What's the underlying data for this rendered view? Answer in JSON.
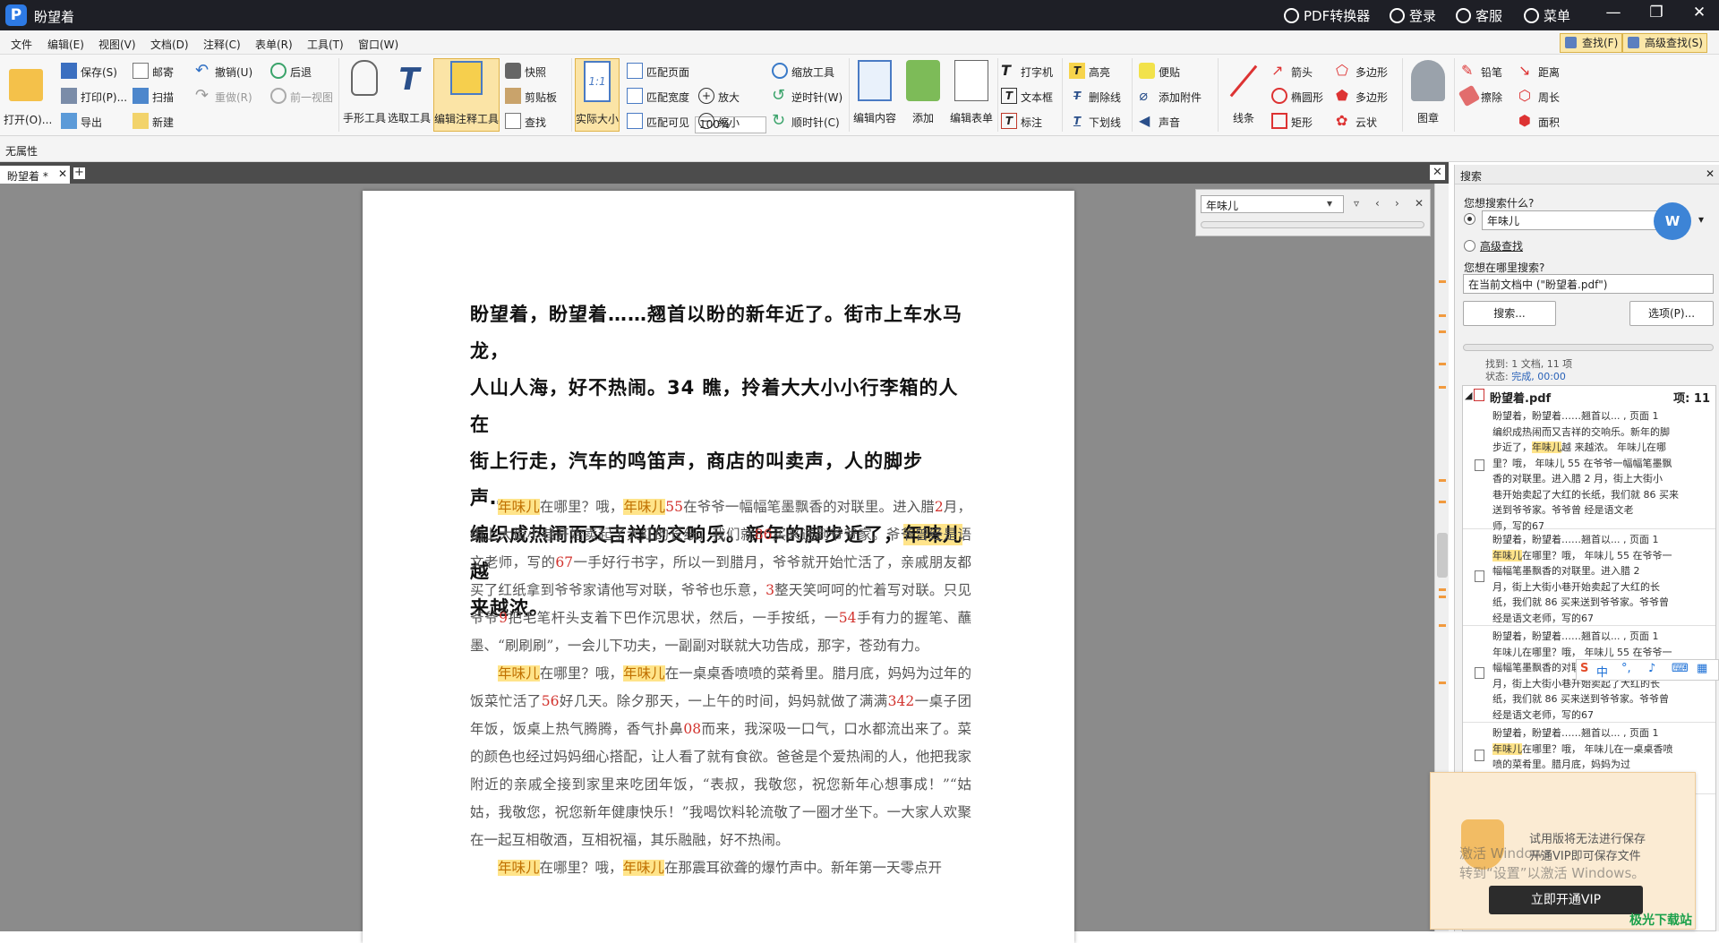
{
  "titlebar": {
    "app_title": "盼望着",
    "pdf_converter": "PDF转换器",
    "login": "登录",
    "service": "客服",
    "menu": "菜单"
  },
  "menubar": {
    "items": [
      "文件",
      "编辑(E)",
      "视图(V)",
      "文档(D)",
      "注释(C)",
      "表单(R)",
      "工具(T)",
      "窗口(W)"
    ],
    "find_btn": "查找(F)",
    "adv_find_btn": "高级查找(S)"
  },
  "ribbon": {
    "open": "打开(O)...",
    "save": "保存(S)",
    "print": "打印(P)...",
    "export": "导出",
    "email": "邮寄",
    "scan": "扫描",
    "new": "新建",
    "undo": "撤销(U)",
    "redo": "重做(R)",
    "back": "后退",
    "forward": "前一视图",
    "hand": "手形工具",
    "select": "选取工具",
    "edit_annot": "编辑注释工具",
    "snapshot": "快照",
    "clipboard": "剪贴板",
    "find": "查找",
    "actual_size": "实际大小",
    "fit_page": "匹配页面",
    "fit_width": "匹配宽度",
    "fit_visible": "匹配可见",
    "zoom_value": "100%",
    "zoom_in": "放大",
    "zoom_out": "缩小",
    "zoom_tool": "缩放工具",
    "ccw": "逆时针(W)",
    "cw": "顺时针(C)",
    "edit_content": "编辑内容",
    "add": "添加",
    "edit_form": "编辑表单",
    "typewriter": "打字机",
    "textbox": "文本框",
    "callout": "标注",
    "highlight": "高亮",
    "strikeout": "删除线",
    "underline": "下划线",
    "note": "便贴",
    "attach": "添加附件",
    "sound": "声音",
    "line": "线条",
    "arrow": "箭头",
    "ellipse": "椭圆形",
    "rect": "矩形",
    "polygon": "多边形",
    "polyline": "多边形",
    "cloud": "云状",
    "stamp": "图章",
    "pencil": "铅笔",
    "eraser": "擦除",
    "distance": "距离",
    "perimeter": "周长",
    "area": "面积"
  },
  "props": {
    "label": "无属性"
  },
  "tab": {
    "name": "盼望着 *"
  },
  "doc": {
    "heading": [
      "盼望着，盼望着……翘首以盼的新年近了。街市上车水马龙，",
      "人山人海，好不热闹。34 瞧，拎着大大小小行李箱的人在",
      "街上行走，汽车的鸣笛声，商店的叫卖声，人的脚步声……",
      "编织成热闹而又吉祥的交响乐。新年的脚步近了，",
      "年味儿",
      "越",
      "来越浓。"
    ],
    "p1": [
      "年味儿",
      "在哪里？哦，",
      "年味儿",
      "55",
      "在爷爷一幅幅笔墨飘香的对联里。进入腊",
      "2",
      "月，街上大街小巷开始卖起了大红的长纸，我们就",
      "86",
      "买来送到爷爷家。爷爷曾经是语文老师，写的",
      "67",
      "一手好行书字，所以一到腊月，爷爷就开始忙活了，亲戚朋友都买了红纸拿到爷爷家请他写对联，爷爷也乐意，",
      "3",
      "整天笑呵呵的忙着写对联。只见爷爷",
      "9",
      "把毛笔杆头支着下巴作沉思状，然后，一手按纸，一",
      "54",
      "手有力的握笔、蘸墨、“刷刷刷”，一会儿下功夫，一副副对联就大功告成，那字，苍劲有力。"
    ],
    "p2": [
      "年味儿",
      "在哪里？哦，",
      "年味儿",
      "在一桌桌香喷喷的菜肴里。腊月底，妈妈为过年的饭菜忙活了",
      "56",
      "好几天。除夕那天，一上午的时间，妈妈就做了满满",
      "342",
      "一桌子团年饭，饭桌上热气腾腾，香气扑鼻",
      "08",
      "而来，我深吸一口气，口水都流出来了。菜的颜色也经过妈妈细心搭配，让人看了就有食欲。爸爸是个爱热闹的人，他把我家附近的亲戚全接到家里来吃团年饭，“表叔，我敬您，祝您新年心想事成！”“姑姑，我敬您，祝您新年健康快乐！”我喝饮料轮流敬了一圈才坐下。一大家人欢聚在一起互相敬酒，互相祝福，其乐融融，好不热闹。"
    ],
    "p3": [
      "年味儿",
      "在哪里？哦，",
      "年味儿",
      "在那震耳欲聋的爆竹声中。新年第一天零点开"
    ]
  },
  "findbar": {
    "query": "年味儿"
  },
  "search": {
    "title": "搜索",
    "what_label": "您想搜索什么?",
    "query": "年味儿",
    "kw_icon": "W",
    "adv_label": "高级查找",
    "where_label": "您想在哪里搜索?",
    "where_value": "在当前文档中 (\"盼望着.pdf\")",
    "search_btn": "搜索...",
    "options_btn": "选项(P)...",
    "found": "找到: 1 文档, 11 项",
    "status_label": "状态:",
    "status_value": "完成, 00:00",
    "file": "盼望着.pdf",
    "count": "项: 11",
    "r1": [
      "盼望着，盼望着……翘首以... , 页面 1",
      "编织成热闹而又吉祥的交响乐。新年的脚",
      "步近了，",
      "年味儿",
      "越 来越浓。 年味儿在哪",
      "里？哦， 年味儿 55 在爷爷一幅幅笔墨飘",
      "香的对联里。进入腊 2 月，街上大街小",
      "巷开始卖起了大红的长纸，我们就 86 买来",
      "送到爷爷家。爷爷曾 经是语文老",
      "师，写的67"
    ],
    "r2": [
      "盼望着，盼望着……翘首以... , 页面 1",
      "年味儿",
      "在哪里？哦， 年味儿 55 在爷爷一",
      "幅幅笔墨飘香的对联里。进入腊 2",
      "月，街上大街小巷开始卖起了大红的长",
      "纸，我们就 86 买来送到爷爷家。爷爷曾",
      "经是语文老师，写的67"
    ],
    "r3": [
      "盼望着，盼望着……翘首以... , 页面 1",
      "年味儿在哪里？哦， 年味儿 55 在爷爷一",
      "幅幅笔墨飘香的对联里。进入腊 2",
      "月，街上大街小巷开始卖起了大红的长",
      "纸，我们就 86 买来送到爷爷家。爷爷曾",
      "经是语文老师，写的67"
    ],
    "r4": [
      "盼望着，盼望着……翘首以... , 页面 1",
      "年味儿",
      "在哪里？哦， 年味儿在一桌桌香喷",
      "喷的菜肴里。腊月底，妈妈为过"
    ]
  },
  "ime": {
    "label": "中"
  },
  "vip": {
    "line1": "试用版将无法进行保存",
    "line2": "开通VIP即可保存文件",
    "button": "立即开通VIP"
  },
  "watermark": {
    "line1": "激活 Windows",
    "line2": "转到“设置”以激活 Windows。"
  },
  "site": {
    "label": "极光下载站"
  }
}
